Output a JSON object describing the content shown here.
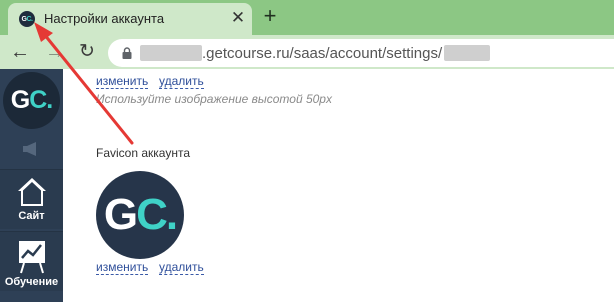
{
  "browser": {
    "tab": {
      "favicon_text_main": "G",
      "favicon_text_accent": "C.",
      "title": "Настройки аккаунта",
      "close_glyph": "✕"
    },
    "new_tab_glyph": "+",
    "toolbar": {
      "back_glyph": "←",
      "forward_glyph": "→",
      "reload_glyph": "↻"
    },
    "url": {
      "visible_text": ".getcourse.ru/saas/account/settings/"
    },
    "colors": {
      "tabstrip": "#8cc784",
      "toolbar": "#cfe8c9"
    }
  },
  "sidebar": {
    "logo": {
      "main": "G",
      "accent": "C."
    },
    "items": [
      {
        "label": "Сайт",
        "icon": "house-icon"
      },
      {
        "label": "Обучение",
        "icon": "chart-board-icon"
      }
    ],
    "colors": {
      "background": "#2e4056",
      "accent": "#3fd2c7"
    }
  },
  "main": {
    "logo_section": {
      "change_link": "изменить",
      "delete_link": "удалить",
      "hint": "Используйте изображение высотой 50px"
    },
    "favicon_section": {
      "label": "Favicon аккаунта",
      "preview": {
        "main": "G",
        "accent": "C."
      },
      "change_link": "изменить",
      "delete_link": "удалить"
    }
  },
  "annotation": {
    "arrow_color": "#e53935",
    "points_to": "tab-favicon"
  }
}
